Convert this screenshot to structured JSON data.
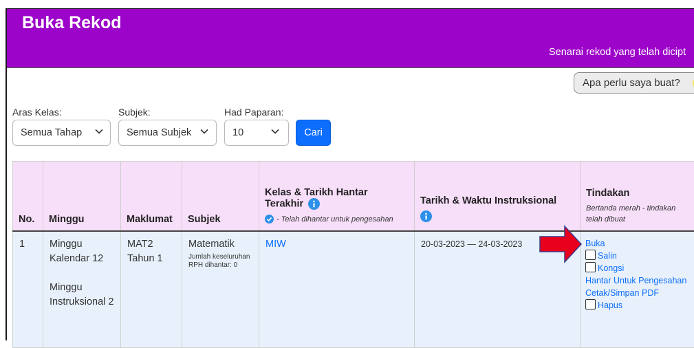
{
  "header": {
    "title": "Buka Rekod",
    "subtitle": "Senarai rekod yang telah dicipt"
  },
  "help_button": {
    "label": "Apa perlu saya buat?"
  },
  "filters": {
    "aras_kelas": {
      "label": "Aras Kelas:",
      "value": "Semua Tahap"
    },
    "subjek": {
      "label": "Subjek:",
      "value": "Semua Subjek"
    },
    "had_paparan": {
      "label": "Had Paparan:",
      "value": "10"
    },
    "search_label": "Cari"
  },
  "table": {
    "headers": {
      "no": "No.",
      "minggu": "Minggu",
      "maklumat": "Maklumat",
      "subjek": "Subjek",
      "kelas_title": "Kelas & Tarikh Hantar Terakhir",
      "kelas_note": "- Telah dihantar untuk pengesahan",
      "tarikh_title": "Tarikh & Waktu Instruksional",
      "tindakan_title": "Tindakan",
      "tindakan_note": "Bertanda merah - tindakan telah dibuat"
    },
    "rows": [
      {
        "no": "1",
        "minggu_kalendar": "Minggu Kalendar 12",
        "minggu_instruksional": "Minggu Instruksional 2",
        "maklumat": "MAT2 Tahun 1",
        "subjek": "Matematik",
        "subjek_note": "Jumlah keseluruhan RPH dihantar: 0",
        "kelas": "MIW",
        "tarikh": "20-03-2023 — 24-03-2023",
        "actions": {
          "buka": "Buka",
          "salin": "Salin",
          "kongsi": "Kongsi",
          "hantar": "Hantar Untuk Pengesahan",
          "cetak": "Cetak/Simpan PDF",
          "hapus": "Hapus"
        }
      }
    ]
  },
  "colors": {
    "header_bg": "#9d04c9",
    "header_row_bg": "#f7def9",
    "body_row_bg": "#e8f1fb",
    "link": "#0d6efd",
    "arrow": "#e8001c"
  },
  "icons": [
    "info-icon",
    "check-circle-icon",
    "chevron-down-icon",
    "red-arrow-icon"
  ]
}
